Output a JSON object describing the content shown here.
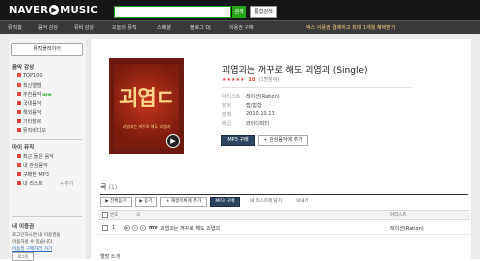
{
  "header": {
    "logo_naver": "NAVER",
    "logo_music": "MUSIC",
    "search_placeholder": "",
    "search_button": "검색",
    "integrated_search": "통합검색"
  },
  "nav": {
    "items": [
      "뮤직홈",
      "음악 감상",
      "뮤비 감상",
      "오늘의 뮤직",
      "스페셜",
      "블로그 DJ",
      "이용권 구매"
    ],
    "promo": "벅스 이용권 결제하고 최대 1개월 혜택받기"
  },
  "sidebar": {
    "player_button": "뮤직플레이어",
    "listen_title": "음악 감상",
    "listen_items": [
      {
        "label": "TOP100",
        "new": ""
      },
      {
        "label": "최신앨범",
        "new": ""
      },
      {
        "label": "추천음악",
        "new": "NEW"
      },
      {
        "label": "국내음악",
        "new": ""
      },
      {
        "label": "해외음악",
        "new": ""
      },
      {
        "label": "기타장르",
        "new": ""
      },
      {
        "label": "뮤직비디오",
        "new": ""
      }
    ],
    "my_title": "마이 뮤직",
    "my_items": [
      "최근 들은 음악",
      "내 관심음악",
      "구매한 MP3",
      "내 리스트"
    ],
    "my_add": "+추가",
    "info_title": "내 이용권",
    "info_line1": "로그인하시면 내 이용권을",
    "info_line2": "이용하실 수 있습니다.",
    "info_line3": "이용권 구매하러 가기",
    "login_button": "로그인"
  },
  "album": {
    "cover_text": "괴엽ㄷ",
    "cover_sub": "괴엽괴는 꺼꾸로 해도 괴엽괴",
    "title": "괴엽괴는 꺼꾸로 해도 괴엽괴 (Single)",
    "stars": "★★★★★",
    "rating": "10",
    "rating_count": "(1명참여)",
    "rating_fraction": 1.0,
    "meta": [
      {
        "key": "아티스트",
        "value": "레이션(Ration)"
      },
      {
        "key": "장르",
        "value": "랩/힙합"
      },
      {
        "key": "발매",
        "value": "2010.10.13"
      },
      {
        "key": "배급",
        "value": "와이디피티"
      }
    ],
    "mp3_button": "MP3 구매",
    "fav_button": "+ 관심음악에 추가"
  },
  "tracks": {
    "section_title": "곡",
    "count": "(1)",
    "toolbar": {
      "listen_all": "▶ 전체듣기",
      "listen": "▶ 듣기",
      "add_playlist": "+ 재생목록에 추가",
      "mp3": "MP3 구매",
      "add_list": "내 리스트에 담기",
      "share": "보내기"
    },
    "headers": {
      "no": "번호",
      "title": "곡",
      "artist": "아티스트"
    },
    "rows": [
      {
        "no": "1",
        "mv": "mv",
        "title": "괴엽괴는 꺼꾸로 해도 괴엽괴",
        "artist": "레이션(Ration)"
      }
    ]
  },
  "bottom": {
    "section_title": "앨범 소개"
  }
}
